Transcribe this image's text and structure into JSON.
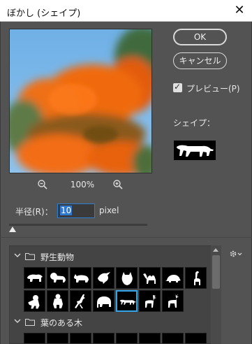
{
  "window": {
    "title": "ぼかし (シェイプ)",
    "close_glyph": "✕"
  },
  "buttons": {
    "ok": "OK",
    "cancel": "キャンセル"
  },
  "preview_toggle": {
    "label": "プレビュー(P)",
    "checked": true
  },
  "shape": {
    "label": "シェイプ：",
    "selected_icon": "panther-icon"
  },
  "zoom": {
    "level": "100%",
    "zoom_out_icon": "zoom-out-icon",
    "zoom_in_icon": "zoom-in-icon"
  },
  "radius": {
    "label": "半径(R)：",
    "value": "10",
    "unit": "pixel"
  },
  "library": {
    "groups": [
      {
        "name": "野生動物",
        "expanded": true,
        "items": [
          "polar-bear-icon",
          "lion-icon",
          "rhino-icon",
          "bird-icon",
          "wolf-icon",
          "camel-icon",
          "turtle-icon",
          "giraffe-icon",
          "monkey-icon",
          "gorilla-icon",
          "deer-icon",
          "elephant-icon",
          "panther-icon",
          "moose-icon",
          "reindeer-icon"
        ],
        "selected_index": 12
      },
      {
        "name": "葉のある木",
        "expanded": true
      }
    ]
  },
  "colors": {
    "accent": "#34a3e8",
    "dialog_bg": "#535353",
    "flower_orange": "#ff6a00"
  }
}
